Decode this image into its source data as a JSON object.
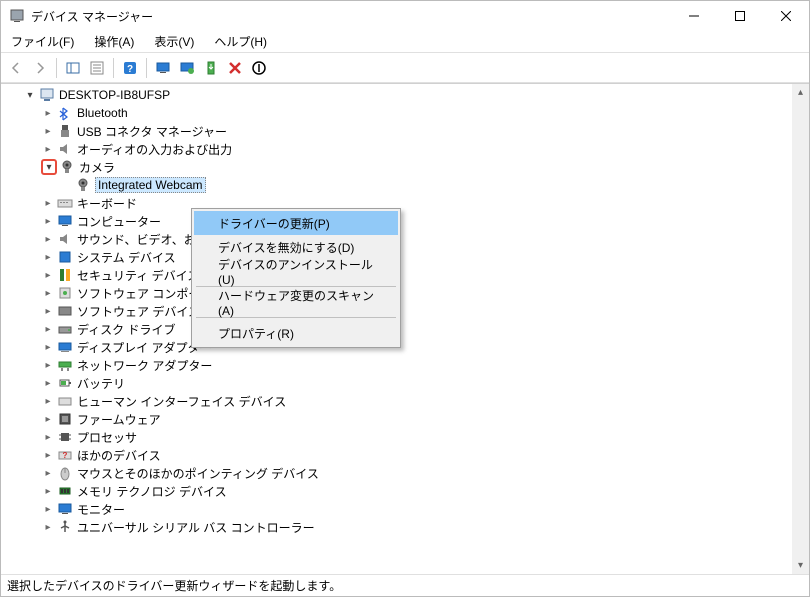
{
  "window": {
    "title": "デバイス マネージャー"
  },
  "menu": {
    "file": "ファイル(F)",
    "action": "操作(A)",
    "view": "表示(V)",
    "help": "ヘルプ(H)"
  },
  "tree": {
    "root": "DESKTOP-IB8UFSP",
    "bluetooth": "Bluetooth",
    "usb_connector_mgr": "USB コネクタ マネージャー",
    "audio_io": "オーディオの入力および出力",
    "camera": "カメラ",
    "integrated_webcam": "Integrated Webcam",
    "keyboard": "キーボード",
    "computer": "コンピューター",
    "sound_video": "サウンド、ビデオ、およ",
    "system_devices": "システム デバイス",
    "security_devices": "セキュリティ デバイス",
    "software_components": "ソフトウェア コンポーネン",
    "software_devices": "ソフトウェア デバイス",
    "disk_drives": "ディスク ドライブ",
    "display_adapters": "ディスプレイ アダプター",
    "network_adapters": "ネットワーク アダプター",
    "batteries": "バッテリ",
    "hid": "ヒューマン インターフェイス デバイス",
    "firmware": "ファームウェア",
    "processors": "プロセッサ",
    "other_devices": "ほかのデバイス",
    "mice": "マウスとそのほかのポインティング デバイス",
    "memory_tech": "メモリ テクノロジ デバイス",
    "monitors": "モニター",
    "usb_controllers": "ユニバーサル シリアル バス コントローラー"
  },
  "context_menu": {
    "update_driver": "ドライバーの更新(P)",
    "disable_device": "デバイスを無効にする(D)",
    "uninstall_device": "デバイスのアンインストール(U)",
    "scan_hardware": "ハードウェア変更のスキャン(A)",
    "properties": "プロパティ(R)"
  },
  "status": "選択したデバイスのドライバー更新ウィザードを起動します。"
}
